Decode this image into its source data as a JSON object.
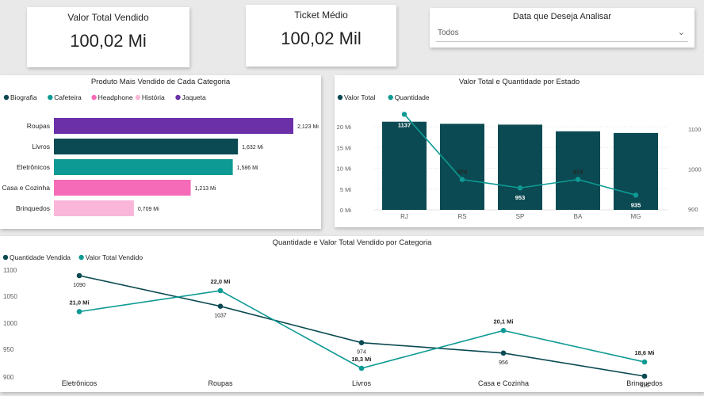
{
  "kpis": {
    "valor_total": {
      "title": "Valor Total Vendido",
      "value": "100,02 Mi"
    },
    "ticket_medio": {
      "title": "Ticket Médio",
      "value": "100,02 Mil"
    }
  },
  "slicer": {
    "title": "Data que Deseja Analisar",
    "value": "Todos"
  },
  "colors": {
    "dark": "#0b4a52",
    "teal": "#0e9a94",
    "purple": "#7030a0",
    "pink": "#f56bb8",
    "light_pink": "#f9b6d9",
    "jaqueta": "#6b30a8"
  },
  "chart_data": [
    {
      "type": "bar",
      "orientation": "horizontal",
      "title": "Produto Mais Vendido de Cada Categoria",
      "legend": [
        {
          "name": "Biografia",
          "color": "#0b4a52"
        },
        {
          "name": "Cafeteira",
          "color": "#0e9a94"
        },
        {
          "name": "Headphone",
          "color": "#f56bb8"
        },
        {
          "name": "História",
          "color": "#f9b6d9"
        },
        {
          "name": "Jaqueta",
          "color": "#6b30a8"
        }
      ],
      "categories": [
        "Roupas",
        "Livros",
        "Eletrônicos",
        "Casa e Cozinha",
        "Brinquedos"
      ],
      "values": [
        2.123,
        1.632,
        1.586,
        1.213,
        0.709
      ],
      "labels": [
        "2,123 Mi",
        "1,632 Mi",
        "1,586 Mi",
        "1,213 Mi",
        "0,709 Mi"
      ],
      "bar_colors": [
        "#6b30a8",
        "#0b4a52",
        "#0e9a94",
        "#f56bb8",
        "#f9b6d9"
      ],
      "xlim": [
        0,
        2.3
      ]
    },
    {
      "type": "bar",
      "title": "Valor Total e Quantidade por Estado",
      "legend": [
        {
          "name": "Valor Total",
          "color": "#0b4a52"
        },
        {
          "name": "Quantidade",
          "color": "#0e9a94"
        }
      ],
      "categories": [
        "RJ",
        "RS",
        "SP",
        "BA",
        "MG"
      ],
      "series": [
        {
          "name": "Valor Total",
          "type": "bar",
          "values": [
            21.2,
            20.7,
            20.5,
            18.9,
            18.5
          ]
        },
        {
          "name": "Quantidade",
          "type": "line",
          "values": [
            1137,
            974,
            953,
            974,
            935
          ],
          "labels": [
            "1137",
            "974",
            "953",
            "974",
            "935"
          ]
        }
      ],
      "y_ticks": [
        "0 Mi",
        "5 Mi",
        "10 Mi",
        "15 Mi",
        "20 Mi"
      ],
      "ylim": [
        0,
        23
      ],
      "y2_ticks": [
        "900",
        "1000",
        "1100"
      ],
      "y2lim": [
        888,
        1143
      ]
    },
    {
      "type": "line",
      "title": "Quantidade e Valor Total Vendido por Categoria",
      "legend": [
        {
          "name": "Quantidade Vendida",
          "color": "#0b4a52"
        },
        {
          "name": "Valor Total Vendido",
          "color": "#0e9a94"
        }
      ],
      "categories": [
        "Eletrônicos",
        "Roupas",
        "Livros",
        "Casa e Cozinha",
        "Brinquedos"
      ],
      "series": [
        {
          "name": "Quantidade Vendida",
          "values": [
            1090,
            1037,
            974,
            956,
            916
          ],
          "labels": [
            "1090",
            "1037",
            "974",
            "956",
            "916"
          ]
        },
        {
          "name": "Valor Total Vendido",
          "values": [
            21.0,
            22.0,
            18.3,
            20.1,
            18.6
          ],
          "labels": [
            "21,0 Mi",
            "22,0 Mi",
            "18,3 Mi",
            "20,1 Mi",
            "18,6 Mi"
          ]
        }
      ],
      "y_ticks": [
        "900",
        "950",
        "1000",
        "1050",
        "1100"
      ],
      "ylim": [
        900,
        1100
      ],
      "y2lim": [
        17.55,
        24.45
      ]
    }
  ]
}
